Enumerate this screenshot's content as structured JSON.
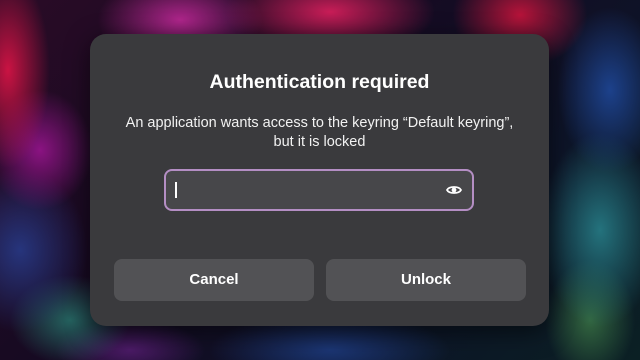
{
  "dialog": {
    "title": "Authentication required",
    "message": "An application wants access to the keyring “Default keyring”, but it is locked",
    "password": {
      "value": "",
      "placeholder": "",
      "reveal_icon": "eye-icon"
    },
    "buttons": {
      "cancel_label": "Cancel",
      "unlock_label": "Unlock"
    }
  },
  "colors": {
    "dialog_bg": "#3a3a3d",
    "button_bg": "#525255",
    "field_focus_border": "#b48ec4",
    "text": "#ffffff"
  }
}
